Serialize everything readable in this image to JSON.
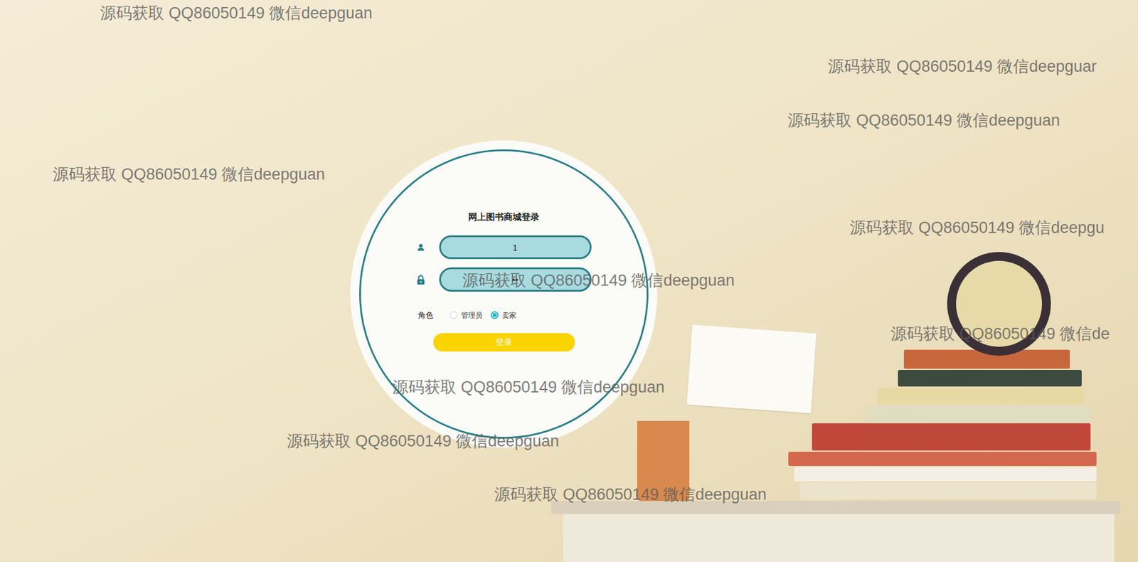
{
  "login": {
    "title": "网上图书商城登录",
    "username": {
      "value": "1"
    },
    "password": {
      "value": "••"
    },
    "role_label": "角色",
    "roles": [
      {
        "label": "管理员",
        "selected": false
      },
      {
        "label": "卖家",
        "selected": true
      }
    ],
    "submit": "登录"
  },
  "watermarks": [
    "源码获取 QQ86050149 微信deepguan",
    "源码获取 QQ86050149 微信deepguar",
    "源码获取 QQ86050149 微信deepguan",
    "源码获取 QQ86050149 微信deepguan",
    "源码获取 QQ86050149 微信deepgu",
    "源码获取 QQ86050149 微信deepguan",
    "源码获取 QQ86050149 微信de",
    "源码获取 QQ86050149 微信deepguan",
    "源码获取 QQ86050149 微信deepguan",
    "源码获取 QQ86050149 微信deepguan"
  ]
}
